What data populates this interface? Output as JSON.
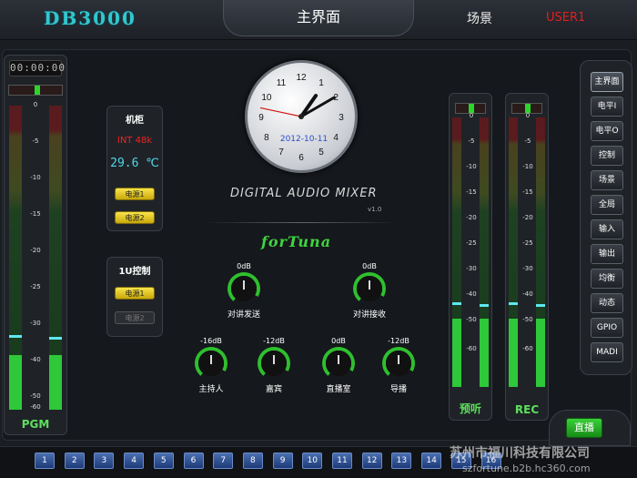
{
  "header": {
    "logo": "DB3000",
    "tab_main": "主界面",
    "tab_scene": "场景",
    "user": "USER1"
  },
  "pgm": {
    "timecode": "00:00:00",
    "label": "PGM",
    "scale": [
      "0",
      "-5",
      "-10",
      "-15",
      "-20",
      "-25",
      "-30",
      "-40",
      "-50",
      "-60"
    ],
    "level_fraction": 0.2
  },
  "cabinet": {
    "title": "机柜",
    "int": "INT 48k",
    "temp": "29.6 ℃",
    "power1": "电源1",
    "power2": "电源2"
  },
  "control1u": {
    "title": "1U控制",
    "power1": "电源1",
    "power2": "电源2"
  },
  "clock": {
    "date": "2012-10-11",
    "hour": 1,
    "minute": 10,
    "second": 47
  },
  "brand": {
    "name": "DIGITAL AUDIO MIXER",
    "version": "v1.0",
    "logo": "forTuna"
  },
  "knobs": [
    {
      "value": "0dB",
      "label": "对讲发送"
    },
    {
      "value": "0dB",
      "label": "对讲接收"
    },
    {
      "value": "-16dB",
      "label": "主持人"
    },
    {
      "value": "-12dB",
      "label": "嘉宾"
    },
    {
      "value": "0dB",
      "label": "直播室"
    },
    {
      "value": "-12dB",
      "label": "导播"
    }
  ],
  "preview": {
    "label": "预听",
    "scale": [
      "0",
      "-5",
      "-10",
      "-15",
      "-20",
      "-25",
      "-30",
      "-40",
      "-50",
      "-60"
    ]
  },
  "rec": {
    "label": "REC",
    "scale": [
      "0",
      "-5",
      "-10",
      "-15",
      "-20",
      "-25",
      "-30",
      "-40",
      "-50",
      "-60"
    ]
  },
  "nav": [
    "主界面",
    "电平I",
    "电平O",
    "控制",
    "场景",
    "全局",
    "输入",
    "输出",
    "均衡",
    "动态",
    "GPIO",
    "MADI"
  ],
  "live": "直播",
  "pages": [
    "1",
    "2",
    "3",
    "4",
    "5",
    "6",
    "7",
    "8",
    "9",
    "10",
    "11",
    "12",
    "13",
    "14",
    "15",
    "16"
  ],
  "watermark": {
    "line1": "苏州市福川科技有限公司",
    "line2": "szfortune.b2b.hc360.com"
  }
}
